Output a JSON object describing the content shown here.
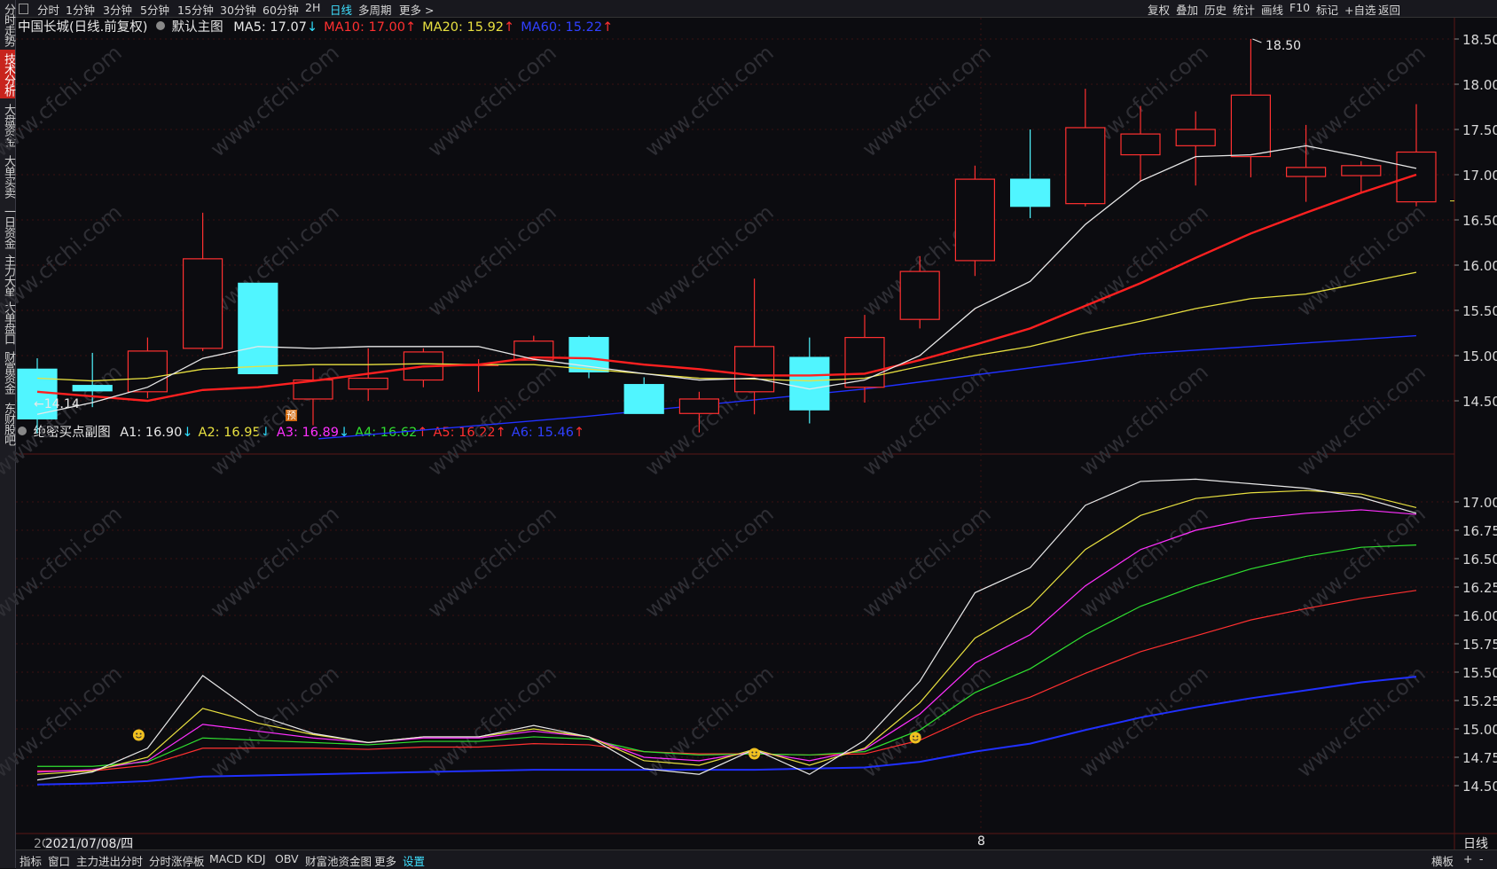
{
  "sidebar": {
    "tabs": [
      {
        "label": "分时走势",
        "active": false
      },
      {
        "label": "技术分析",
        "active": true
      },
      {
        "label": "大盘资金",
        "active": false
      },
      {
        "label": "大单买卖",
        "active": false
      },
      {
        "label": "一日资金",
        "active": false
      },
      {
        "label": "主力大单",
        "active": false
      },
      {
        "label": "大单盘口",
        "active": false
      },
      {
        "label": "财富资金",
        "active": false
      },
      {
        "label": "东财股吧",
        "active": false
      }
    ]
  },
  "toolbar": {
    "periods": [
      "分时",
      "1分钟",
      "3分钟",
      "5分钟",
      "15分钟",
      "30分钟",
      "60分钟",
      "2H",
      "日线",
      "多周期",
      "更多 >"
    ],
    "active_period": "日线",
    "right_items": [
      "复权",
      "叠加",
      "历史",
      "统计",
      "画线",
      "F10",
      "标记",
      "+自选",
      "返回"
    ]
  },
  "main_chart": {
    "title": "中国长城(日线.前复权)",
    "indicator_name": "默认主图",
    "ma": [
      {
        "label": "MA5: 17.07",
        "arrow": "↓",
        "color": "#e8e8e8"
      },
      {
        "label": "MA10: 17.00",
        "arrow": "↑",
        "color": "#ff3030"
      },
      {
        "label": "MA20: 15.92",
        "arrow": "↑",
        "color": "#e8e040"
      },
      {
        "label": "MA60: 15.22",
        "arrow": "↑",
        "color": "#3040ff"
      }
    ],
    "price_axis": [
      "18.50",
      "18.00",
      "17.50",
      "17.00",
      "16.50",
      "16.00",
      "15.50",
      "15.00",
      "14.50"
    ],
    "high_label": "18.50",
    "low_label": "←14.14",
    "forecast_badge": "预"
  },
  "sub_chart": {
    "title": "绝密买点副图",
    "lines": [
      {
        "label": "A1: 16.90",
        "arrow": "↓",
        "color": "#e8e8e8"
      },
      {
        "label": "A2: 16.95",
        "arrow": "↓",
        "color": "#e8e040"
      },
      {
        "label": "A3: 16.89",
        "arrow": "↓",
        "color": "#ff30ff"
      },
      {
        "label": "A4: 16.62",
        "arrow": "↑",
        "color": "#30e030"
      },
      {
        "label": "A5: 16.22",
        "arrow": "↑",
        "color": "#ff3030"
      },
      {
        "label": "A6: 15.46",
        "arrow": "↑",
        "color": "#3040ff"
      }
    ],
    "axis": [
      "17.00",
      "16.75",
      "16.50",
      "16.25",
      "16.00",
      "15.75",
      "15.50",
      "15.25",
      "15.00",
      "14.75",
      "14.50"
    ]
  },
  "date_axis": {
    "cursor_date": "2021/07/08/四",
    "cursor_prefix": "2C",
    "month_mark": "8",
    "period_label": "日线"
  },
  "bottom_bar": {
    "items": [
      "指标",
      "窗口",
      "主力进出分时",
      "分时涨停板",
      "MACD",
      "KDJ",
      "OBV",
      "财富池资金图",
      "更多",
      "设置"
    ],
    "active": "设置",
    "right_items": [
      "横板",
      "+",
      "-"
    ]
  },
  "watermark": "www.cfchi.com",
  "chart_data": [
    {
      "type": "candlestick",
      "title": "中国长城(日线.前复权)",
      "ylim": [
        14.0,
        18.65
      ],
      "candles": [
        {
          "o": 14.85,
          "h": 14.97,
          "l": 14.14,
          "c": 14.3
        },
        {
          "o": 14.67,
          "h": 15.03,
          "l": 14.43,
          "c": 14.61
        },
        {
          "o": 14.6,
          "h": 15.2,
          "l": 14.53,
          "c": 15.05
        },
        {
          "o": 15.08,
          "h": 16.58,
          "l": 15.05,
          "c": 16.07
        },
        {
          "o": 15.8,
          "h": 15.8,
          "l": 14.8,
          "c": 14.8
        },
        {
          "o": 14.52,
          "h": 14.86,
          "l": 14.23,
          "c": 14.73
        },
        {
          "o": 14.63,
          "h": 15.08,
          "l": 14.5,
          "c": 14.75
        },
        {
          "o": 14.73,
          "h": 15.08,
          "l": 14.65,
          "c": 15.04
        },
        {
          "o": 14.9,
          "h": 14.96,
          "l": 14.6,
          "c": 14.9
        },
        {
          "o": 14.95,
          "h": 15.22,
          "l": 14.95,
          "c": 15.16
        },
        {
          "o": 15.2,
          "h": 15.22,
          "l": 14.75,
          "c": 14.82
        },
        {
          "o": 14.68,
          "h": 14.76,
          "l": 14.36,
          "c": 14.36
        },
        {
          "o": 14.36,
          "h": 14.6,
          "l": 14.15,
          "c": 14.52
        },
        {
          "o": 14.6,
          "h": 15.85,
          "l": 14.35,
          "c": 15.1
        },
        {
          "o": 14.98,
          "h": 15.2,
          "l": 14.25,
          "c": 14.4
        },
        {
          "o": 14.65,
          "h": 15.45,
          "l": 14.48,
          "c": 15.2
        },
        {
          "o": 15.4,
          "h": 16.1,
          "l": 15.3,
          "c": 15.93
        },
        {
          "o": 16.05,
          "h": 17.1,
          "l": 15.88,
          "c": 16.95
        },
        {
          "o": 16.95,
          "h": 17.5,
          "l": 16.52,
          "c": 16.65
        },
        {
          "o": 16.68,
          "h": 17.95,
          "l": 16.65,
          "c": 17.52
        },
        {
          "o": 17.22,
          "h": 17.76,
          "l": 16.93,
          "c": 17.45
        },
        {
          "o": 17.32,
          "h": 17.7,
          "l": 16.88,
          "c": 17.5
        },
        {
          "o": 17.2,
          "h": 18.5,
          "l": 16.97,
          "c": 17.88
        },
        {
          "o": 16.98,
          "h": 17.55,
          "l": 16.7,
          "c": 17.08
        },
        {
          "o": 16.99,
          "h": 17.15,
          "l": 16.8,
          "c": 17.1
        },
        {
          "o": 16.7,
          "h": 17.78,
          "l": 16.65,
          "c": 17.25
        }
      ],
      "ma5": [
        14.35,
        14.48,
        14.65,
        14.97,
        15.1,
        15.08,
        15.1,
        15.1,
        15.1,
        14.96,
        14.88,
        14.8,
        14.73,
        14.75,
        14.63,
        14.73,
        15.0,
        15.52,
        15.82,
        16.45,
        16.93,
        17.2,
        17.22,
        17.32,
        17.2,
        17.07
      ],
      "ma10": [
        14.6,
        14.55,
        14.5,
        14.62,
        14.65,
        14.72,
        14.8,
        14.88,
        14.9,
        14.98,
        14.97,
        14.9,
        14.85,
        14.78,
        14.78,
        14.8,
        14.95,
        15.12,
        15.3,
        15.55,
        15.8,
        16.08,
        16.35,
        16.58,
        16.8,
        17.0
      ],
      "ma20": [
        14.75,
        14.72,
        14.75,
        14.85,
        14.88,
        14.9,
        14.9,
        14.91,
        14.9,
        14.9,
        14.85,
        14.8,
        14.75,
        14.74,
        14.72,
        14.75,
        14.88,
        15.0,
        15.1,
        15.25,
        15.38,
        15.52,
        15.63,
        15.68,
        15.8,
        15.92
      ],
      "ma60": [
        null,
        null,
        null,
        null,
        null,
        null,
        null,
        null,
        null,
        null,
        null,
        null,
        null,
        null,
        null,
        null,
        null,
        null,
        null,
        null,
        null,
        null,
        null,
        null,
        null,
        15.22
      ],
      "ma60_line": [
        14.08,
        14.33,
        14.63,
        15.02,
        15.22
      ]
    },
    {
      "type": "line",
      "title": "绝密买点副图",
      "ylim": [
        14.22,
        17.3
      ],
      "series": [
        {
          "name": "A1",
          "values": [
            14.55,
            14.62,
            14.83,
            15.47,
            15.12,
            14.96,
            14.88,
            14.93,
            14.93,
            15.03,
            14.93,
            14.65,
            14.6,
            14.82,
            14.6,
            14.9,
            15.42,
            16.2,
            16.42,
            16.97,
            17.18,
            17.2,
            17.16,
            17.12,
            17.04,
            16.9
          ]
        },
        {
          "name": "A2",
          "values": [
            14.6,
            14.63,
            14.75,
            15.18,
            15.05,
            14.95,
            14.88,
            14.93,
            14.93,
            15.0,
            14.93,
            14.72,
            14.68,
            14.82,
            14.68,
            14.83,
            15.23,
            15.8,
            16.08,
            16.58,
            16.88,
            17.03,
            17.08,
            17.1,
            17.07,
            16.95
          ]
        },
        {
          "name": "A3",
          "values": [
            14.62,
            14.64,
            14.72,
            15.04,
            14.98,
            14.92,
            14.88,
            14.92,
            14.92,
            14.98,
            14.93,
            14.75,
            14.72,
            14.8,
            14.72,
            14.82,
            15.13,
            15.58,
            15.83,
            16.26,
            16.58,
            16.75,
            16.85,
            16.9,
            16.93,
            16.89
          ]
        },
        {
          "name": "A4",
          "values": [
            14.67,
            14.67,
            14.71,
            14.92,
            14.9,
            14.88,
            14.86,
            14.89,
            14.89,
            14.93,
            14.91,
            14.8,
            14.77,
            14.78,
            14.77,
            14.8,
            14.99,
            15.32,
            15.53,
            15.83,
            16.08,
            16.26,
            16.41,
            16.52,
            16.6,
            16.62
          ]
        },
        {
          "name": "A5",
          "values": [
            14.63,
            14.63,
            14.68,
            14.83,
            14.83,
            14.83,
            14.82,
            14.84,
            14.84,
            14.87,
            14.86,
            14.8,
            14.78,
            14.78,
            14.77,
            14.78,
            14.9,
            15.12,
            15.28,
            15.49,
            15.68,
            15.82,
            15.96,
            16.06,
            16.15,
            16.22
          ]
        },
        {
          "name": "A6",
          "values": [
            14.51,
            14.52,
            14.54,
            14.58,
            14.59,
            14.6,
            14.61,
            14.62,
            14.63,
            14.64,
            14.64,
            14.64,
            14.64,
            14.64,
            14.65,
            14.66,
            14.71,
            14.8,
            14.87,
            14.99,
            15.1,
            15.19,
            15.27,
            15.34,
            15.41,
            15.46
          ]
        }
      ],
      "signal_markers": [
        2,
        13,
        16
      ]
    }
  ]
}
